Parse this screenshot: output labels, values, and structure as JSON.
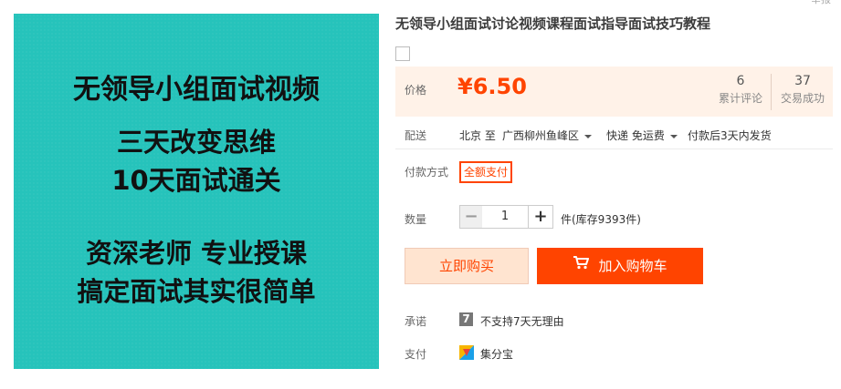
{
  "image": {
    "line1": "无领导小组面试视频",
    "line2": "三天改变思维",
    "line3": "10天面试通关",
    "line4": "资深老师 专业授课",
    "line5": "搞定面试其实很简单",
    "background_color": "#26c3bb"
  },
  "top_corner_text": "举报",
  "product": {
    "title": "无领导小组面试讨论视频课程面试指导面试技巧教程"
  },
  "price": {
    "label": "价格",
    "value": "¥6.50",
    "reviews_count": "6",
    "reviews_label": "累计评论",
    "sales_count": "37",
    "sales_label": "交易成功"
  },
  "shipping": {
    "label": "配送",
    "origin": "北京 至",
    "destination": "广西柳州鱼峰区",
    "method": "快递 免运费",
    "delivery": "付款后3天内发货"
  },
  "payment": {
    "label": "付款方式",
    "option": "全额支付"
  },
  "quantity": {
    "label": "数量",
    "value": "1",
    "minus": "−",
    "plus": "+",
    "stock_text": "件(库存9393件)"
  },
  "actions": {
    "buy_now": "立即购买",
    "add_to_cart": "加入购物车"
  },
  "promise": {
    "label": "承诺",
    "icon_text": "7",
    "text": "不支持7天无理由"
  },
  "pay_methods": {
    "label": "支付",
    "text": "集分宝"
  },
  "colors": {
    "accent": "#ff4400",
    "price_bg": "#fff2e8"
  },
  "icons": {
    "cart": "shopping-cart-icon",
    "promise": "seven-day-icon",
    "pay": "jifenbao-icon"
  }
}
